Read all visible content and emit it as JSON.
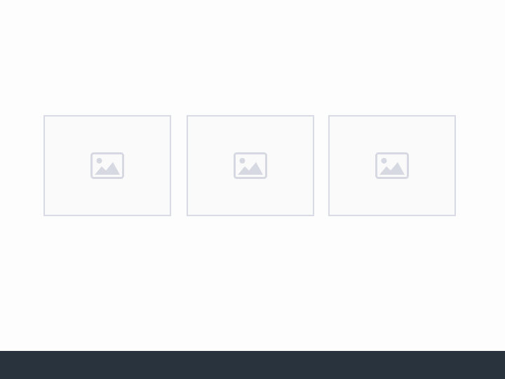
{
  "gallery": {
    "items": [
      {
        "icon": "image-placeholder-icon"
      },
      {
        "icon": "image-placeholder-icon"
      },
      {
        "icon": "image-placeholder-icon"
      }
    ]
  },
  "colors": {
    "background": "#fdfdfd",
    "placeholder_border": "#d8dbe3",
    "placeholder_fill": "#fafafb",
    "icon": "#d6d9e1",
    "footer": "#29333d"
  }
}
